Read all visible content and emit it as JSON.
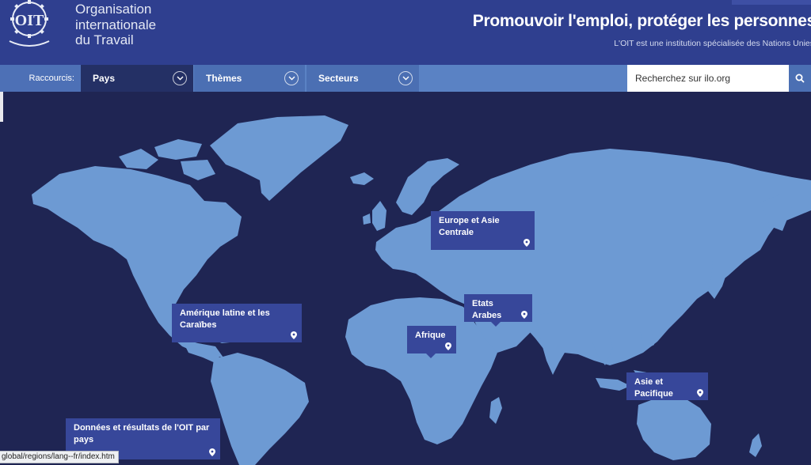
{
  "header": {
    "org_name_lines": [
      "Organisation",
      "internationale",
      "du Travail"
    ],
    "logo_text": "OIT",
    "tagline": "Promouvoir l'emploi, protéger les personnes",
    "subtagline": "L'OIT est une institution spécialisée des Nations Unies"
  },
  "nav": {
    "shortcuts_label": "Raccourcis:",
    "tabs": [
      {
        "label": "Pays"
      },
      {
        "label": "Thèmes"
      },
      {
        "label": "Secteurs"
      }
    ]
  },
  "search": {
    "placeholder": "Recherchez sur ilo.org"
  },
  "regions": [
    {
      "label": "Europe et Asie Centrale"
    },
    {
      "label": "Amérique latine et les Caraïbes"
    },
    {
      "label": "Etats Arabes"
    },
    {
      "label": "Afrique"
    },
    {
      "label": "Asie et Pacifique"
    },
    {
      "label": "Données et résultats de l'OIT par pays"
    }
  ],
  "status_bar": {
    "url": "global/regions/lang--fr/index.htm"
  },
  "colors": {
    "header_bg": "#2f3f8f",
    "nav_bg": "#5a82c4",
    "active_tab": "#243065",
    "map_ocean": "#1f2553",
    "map_land": "#6d9ad3",
    "region_box": "#37479a"
  },
  "icons": [
    "ilo-logo",
    "chevron-down-icon",
    "search-icon",
    "map-pin-icon"
  ]
}
